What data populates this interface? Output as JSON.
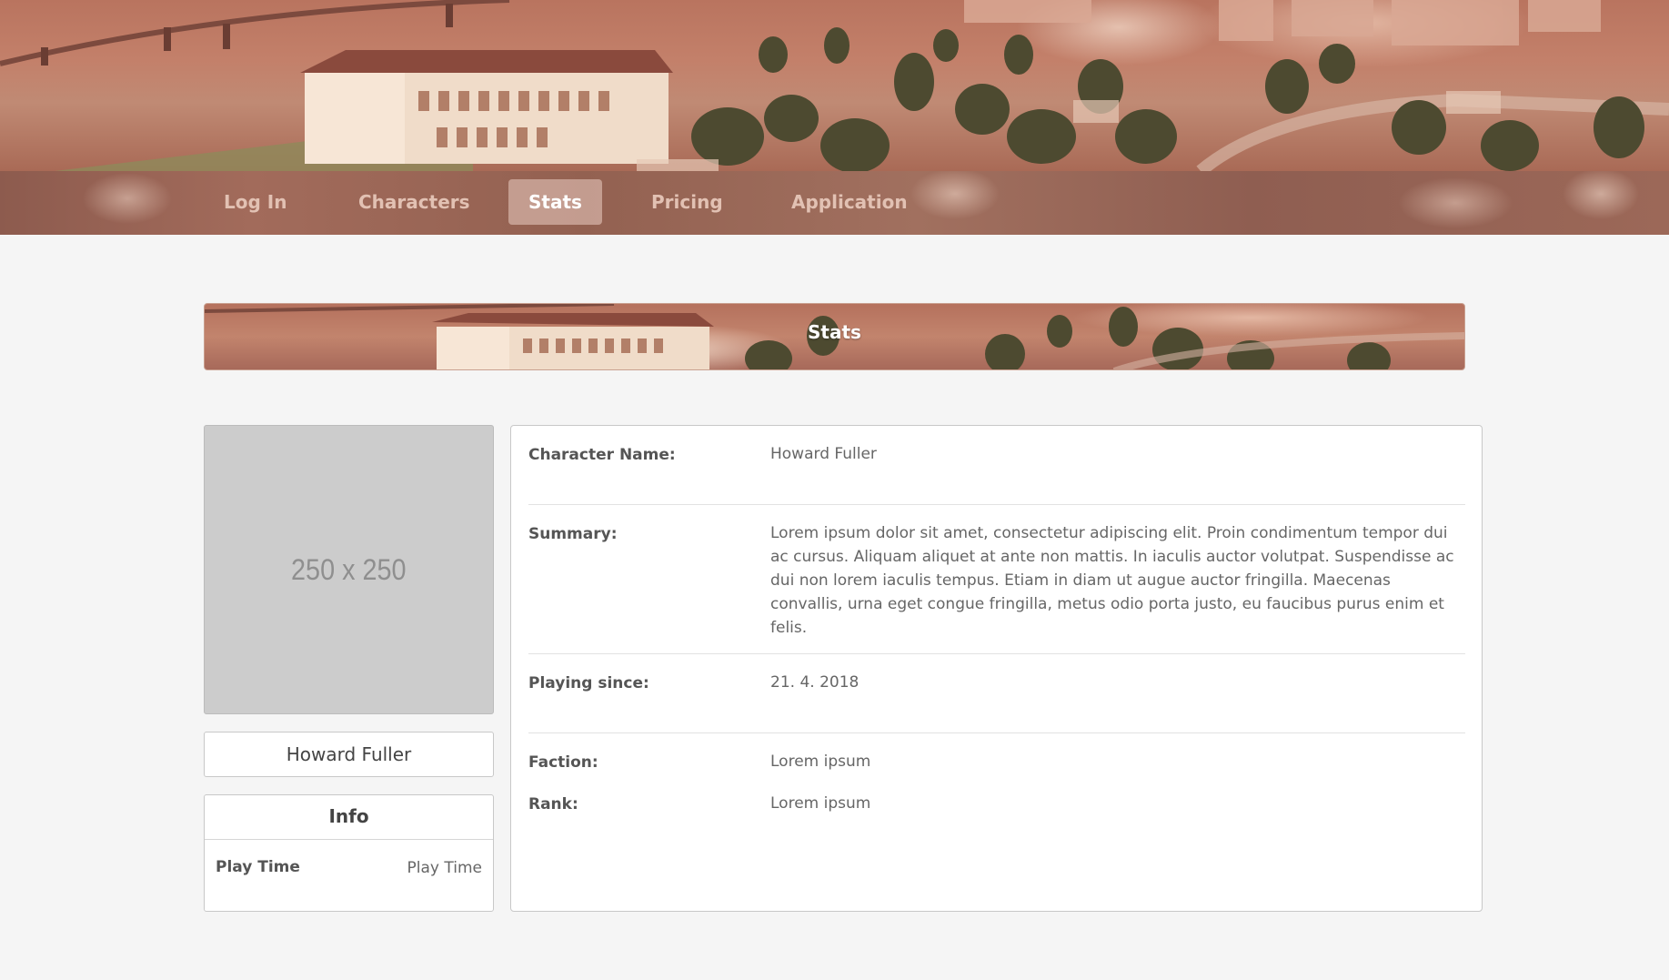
{
  "nav": {
    "items": [
      {
        "label": "Log In"
      },
      {
        "label": "Characters"
      },
      {
        "label": "Stats"
      },
      {
        "label": "Pricing"
      },
      {
        "label": "Application"
      }
    ],
    "active": "Stats"
  },
  "banner": {
    "title": "Stats"
  },
  "profile": {
    "avatar_placeholder": "250 x 250",
    "name": "Howard Fuller",
    "info": {
      "title": "Info",
      "play_time_label": "Play Time",
      "play_time_value": "Play Time"
    }
  },
  "details": {
    "character_name_label": "Character Name:",
    "character_name_value": "Howard Fuller",
    "summary_label": "Summary:",
    "summary_value": "Lorem ipsum dolor sit amet, consectetur adipiscing elit. Proin condimentum tempor dui ac cursus. Aliquam aliquet at ante non mattis. In iaculis auctor volutpat. Suspendisse ac dui non lorem iaculis tempus. Etiam in diam ut augue auctor fringilla. Maecenas convallis, urna eget congue fringilla, metus odio porta justo, eu faucibus purus enim et felis.",
    "playing_since_label": "Playing since:",
    "playing_since_value": "21. 4. 2018",
    "faction_label": "Faction:",
    "faction_value": "Lorem ipsum",
    "rank_label": "Rank:",
    "rank_value": "Lorem ipsum"
  },
  "colors": {
    "page_background": "#f5f5f5",
    "nav_text": "#e2c1b3",
    "nav_active_text": "#ffffff",
    "avatar_placeholder_bg": "#cccccc"
  }
}
